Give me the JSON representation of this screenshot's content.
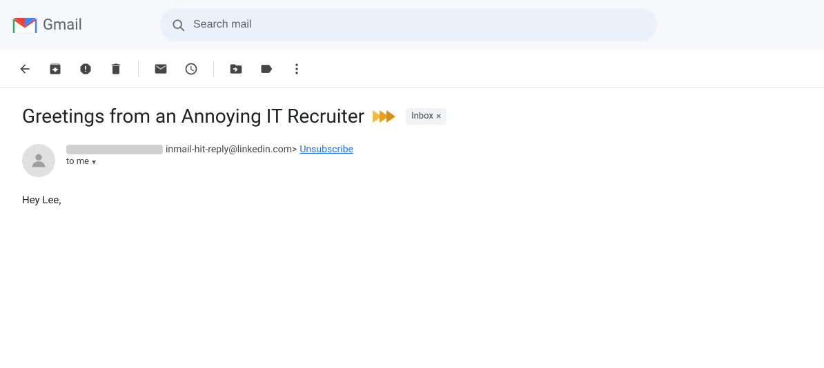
{
  "header": {
    "app_name": "Gmail",
    "search_placeholder": "Search mail"
  },
  "toolbar": {
    "buttons": [
      {
        "name": "back-button",
        "icon": "←",
        "label": "Back"
      },
      {
        "name": "archive-button",
        "icon": "archive",
        "label": "Archive"
      },
      {
        "name": "spam-button",
        "icon": "spam",
        "label": "Report spam"
      },
      {
        "name": "delete-button",
        "icon": "trash",
        "label": "Delete"
      },
      {
        "name": "mark-unread-button",
        "icon": "mail",
        "label": "Mark as unread"
      },
      {
        "name": "snooze-button",
        "icon": "clock",
        "label": "Snooze"
      },
      {
        "name": "move-button",
        "icon": "folder",
        "label": "Move to"
      },
      {
        "name": "label-button",
        "icon": "label",
        "label": "Label"
      },
      {
        "name": "more-button",
        "icon": "more",
        "label": "More"
      }
    ]
  },
  "email": {
    "subject": "Greetings from an Annoying IT Recruiter",
    "tag_label": "Inbox",
    "tag_close": "×",
    "sender_email": "inmail-hit-reply@linkedin.com>",
    "unsubscribe_label": "Unsubscribe",
    "to_label": "to me",
    "body_greeting": "Hey Lee,"
  }
}
